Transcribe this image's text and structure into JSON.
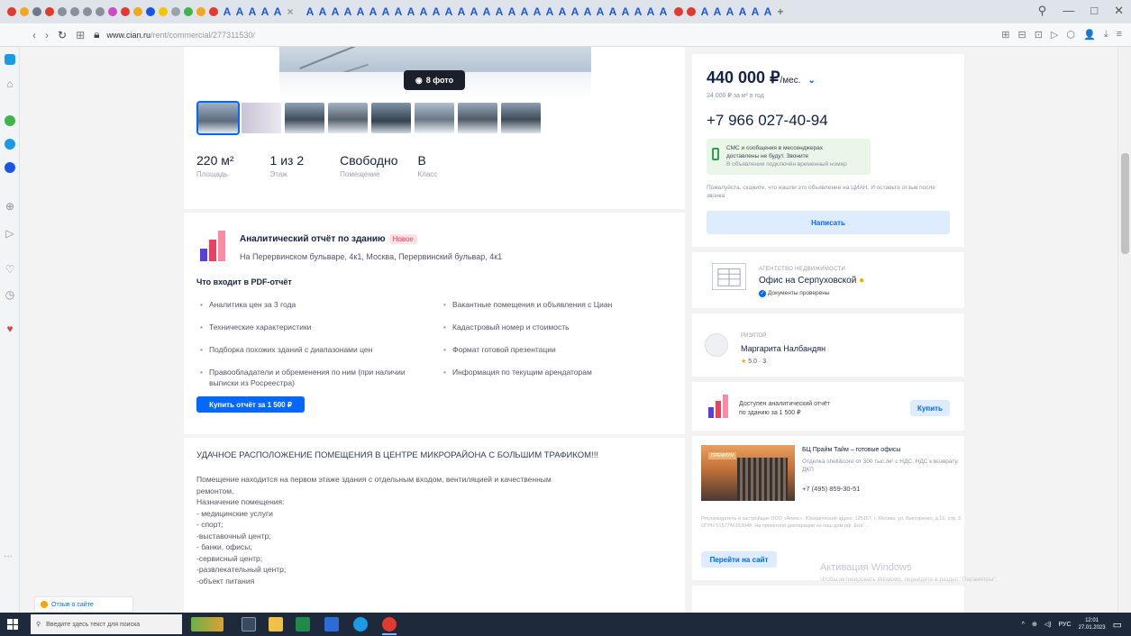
{
  "browser": {
    "url_domain": "www.cian.ru",
    "url_path": "/rent/commercial/277311530/",
    "tab_glyph": "A",
    "win_controls": [
      "—",
      "□",
      "✕"
    ],
    "addr_icons": [
      "⊞",
      "⊟",
      "⊡",
      "▷",
      "⬡",
      "👤",
      "⤓",
      "≡"
    ]
  },
  "listing": {
    "photo_button": "8 фото",
    "stats": [
      {
        "value": "220 м²",
        "label": "Площадь"
      },
      {
        "value": "1 из 2",
        "label": "Этаж"
      },
      {
        "value": "Свободно",
        "label": "Помещение"
      },
      {
        "value": "B",
        "label": "Класс"
      }
    ]
  },
  "report": {
    "title": "Аналитический отчёт по зданию",
    "badge": "Новое",
    "address": "На Перервинском бульваре, 4к1, Москва, Перервинский бульвар, 4к1",
    "includes_title": "Что входит в PDF-отчёт",
    "col1": [
      "Аналитика цен за 3 года",
      "Технические характеристики",
      "Подборка похожих зданий с диапазонами цен",
      "Правообладатели и обременения по ним (при наличии выписки из Росреестра)"
    ],
    "col2": [
      "Вакантные помещения и объявления с Циан",
      "Кадастровый номер и стоимость",
      "Формат готовой презентации",
      "Информация по текущим арендаторам"
    ],
    "buy_button": "Купить отчёт за 1 500 ₽"
  },
  "description": {
    "title": "УДАЧНОЕ РАСПОЛОЖЕНИЕ ПОМЕЩЕНИЯ В ЦЕНТРЕ МИКРОРАЙОНА С БОЛЬШИМ ТРАФИКОМ!!!",
    "lines": [
      "Помещение находится на первом этаже здания с отдельным входом, вентиляцией и качественным",
      "ремонтом.",
      "",
      "Назначение помещения:",
      "- медицинские услуги",
      "- спорт;",
      "-выставочный центр;",
      "- банки, офисы;",
      "-сервисный центр;",
      "-развлекательный центр;",
      "-объект питания"
    ]
  },
  "contact": {
    "price": "440 000 ₽",
    "price_unit": "/мес.",
    "price_sub": "24 000 ₽ за м² в год",
    "phone": "+7 966 027-40-94",
    "sms_line1": "СМС и сообщения в мессенджерах",
    "sms_line2": "доставлены не будут. Звоните",
    "sms_line3": "В объявлении подключён временный номер",
    "note": "Пожалуйста, скажите, что нашли это объявление на ЦИАН. И оставьте отзыв после звонка",
    "write_button": "Написать"
  },
  "agency": {
    "label": "АГЕНТСТВО НЕДВИЖИМОСТИ",
    "name": "Офис на Серпуховской",
    "verified": "Документы проверены"
  },
  "realtor": {
    "label": "РИЭЛТОР",
    "name": "Маргарита Налбандян",
    "rating": "5.0 · 3"
  },
  "mini_report": {
    "text1": "Доступен аналитический отчёт",
    "text2": "по зданию за 1 500 ₽",
    "button": "Купить"
  },
  "ad": {
    "tag": "ПРЕМИУМ",
    "title": "БЦ Прайм Тайм – готовые офисы",
    "text": "Отделка shell&core от 300 тыс./м² с НДС. НДС к возврату. ДКП",
    "phone": "+7 (495) 859-30-51",
    "legal": "Рекламодатель и застройщик ООО «Апекс». Юридический адрес: 125167, г. Москва, ул. Викторенко, д.16, стр. 3. ОГРН 5157746153948. На проектной декларации на наш.дом.рф. Erid: ...",
    "button": "Перейти на сайт"
  },
  "overlay": {
    "watermark": "Активация Windows",
    "watermark_sub": "Чтобы активировать Windows, перейдите в раздел \"Параметры\".",
    "feedback": "Отзыв о сайте",
    "dots": "···"
  },
  "taskbar": {
    "search_placeholder": "Введите здесь текст для поиска",
    "lang": "РУС",
    "time": "12:01",
    "date": "27.01.2023"
  },
  "colors": {
    "accent": "#0468ff",
    "text": "#152242",
    "taskbar": "#1e2a3c"
  }
}
